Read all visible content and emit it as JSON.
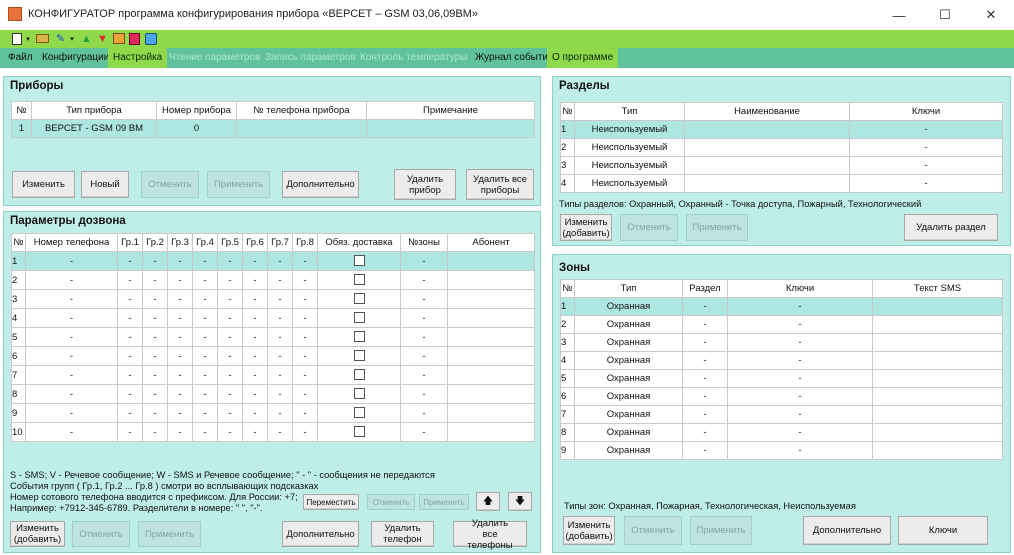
{
  "window": {
    "title": "КОНФИГУРАТОР программа конфигурирования прибора «ВЕРСЕТ – GSM 03,06,09ВМ»",
    "minimize": "—",
    "maximize": "☐",
    "close": "✕"
  },
  "toolbar": {
    "icons": [
      "new-file-icon",
      "open-icon",
      "wizard-icon",
      "upload-icon",
      "download-icon",
      "device-icon",
      "book-icon",
      "settings-icon"
    ]
  },
  "menu": [
    {
      "label": "Файл",
      "state": "normal"
    },
    {
      "label": "Конфигурации",
      "state": "normal"
    },
    {
      "label": "Настройка",
      "state": "active"
    },
    {
      "label": "Чтение параметров",
      "state": "disabled"
    },
    {
      "label": "Запись параметров",
      "state": "disabled"
    },
    {
      "label": "Контроль температуры",
      "state": "disabled"
    },
    {
      "label": "Журнал событий",
      "state": "normal"
    },
    {
      "label": "О программе",
      "state": "active"
    }
  ],
  "devices": {
    "title": "Приборы",
    "columns": [
      "№",
      "Тип прибора",
      "Номер прибора",
      "№ телефона прибора",
      "Примечание"
    ],
    "rows": [
      [
        "1",
        "ВЕРСЕТ - GSM 09 ВМ",
        "0",
        "",
        ""
      ]
    ],
    "buttons": {
      "edit": "Изменить",
      "new": "Новый",
      "cancel": "Отменить",
      "apply": "Применить",
      "extra": "Дополнительно",
      "delete_one": "Удалить прибор",
      "delete_all": "Удалить все приборы"
    }
  },
  "dial": {
    "title": "Параметры дозвона",
    "columns": [
      "№",
      "Номер телефона",
      "Гр.1",
      "Гр.2",
      "Гр.3",
      "Гр.4",
      "Гр.5",
      "Гр.6",
      "Гр.7",
      "Гр.8",
      "Обяз. доставка",
      "№зоны",
      "Абонент"
    ],
    "rows": [
      [
        "1",
        "-",
        "-",
        "-",
        "-",
        "-",
        "-",
        "-",
        "-",
        "-",
        "",
        "-",
        ""
      ],
      [
        "2",
        "-",
        "-",
        "-",
        "-",
        "-",
        "-",
        "-",
        "-",
        "-",
        "",
        "-",
        ""
      ],
      [
        "3",
        "-",
        "-",
        "-",
        "-",
        "-",
        "-",
        "-",
        "-",
        "-",
        "",
        "-",
        ""
      ],
      [
        "4",
        "-",
        "-",
        "-",
        "-",
        "-",
        "-",
        "-",
        "-",
        "-",
        "",
        "-",
        ""
      ],
      [
        "5",
        "-",
        "-",
        "-",
        "-",
        "-",
        "-",
        "-",
        "-",
        "-",
        "",
        "-",
        ""
      ],
      [
        "6",
        "-",
        "-",
        "-",
        "-",
        "-",
        "-",
        "-",
        "-",
        "-",
        "",
        "-",
        ""
      ],
      [
        "7",
        "-",
        "-",
        "-",
        "-",
        "-",
        "-",
        "-",
        "-",
        "-",
        "",
        "-",
        ""
      ],
      [
        "8",
        "-",
        "-",
        "-",
        "-",
        "-",
        "-",
        "-",
        "-",
        "-",
        "",
        "-",
        ""
      ],
      [
        "9",
        "-",
        "-",
        "-",
        "-",
        "-",
        "-",
        "-",
        "-",
        "-",
        "",
        "-",
        ""
      ],
      [
        "10",
        "-",
        "-",
        "-",
        "-",
        "-",
        "-",
        "-",
        "-",
        "-",
        "",
        "-",
        ""
      ]
    ],
    "notes": [
      "S - SMS;  V - Речевое сообщение;  W - SMS и Речевое сообщение; \" - \" - сообщения не передаются",
      "События групп ( Гр.1, Гр.2 ... Гр.8 ) смотри во всплывающих подсказках",
      "Номер сотового телефона вводится с префиксом. Для России: +7;",
      "Например: +7912-345-6789. Разделители в номере: \" \", \"-\"."
    ],
    "mini_buttons": {
      "move": "Переместить",
      "cancel": "Отменить",
      "apply": "Применить",
      "up": "🡅",
      "down": "🡇"
    },
    "buttons": {
      "edit": "Изменить (добавить)",
      "cancel": "Отменить",
      "apply": "Применить",
      "extra": "Дополнительно",
      "delete_one": "Удалить телефон",
      "delete_all": "Удалить все телефоны"
    }
  },
  "sections": {
    "title": "Разделы",
    "columns": [
      "№",
      "Тип",
      "Наименование",
      "Ключи"
    ],
    "rows": [
      [
        "1",
        "Неиспользуемый",
        "",
        "-"
      ],
      [
        "2",
        "Неиспользуемый",
        "",
        "-"
      ],
      [
        "3",
        "Неиспользуемый",
        "",
        "-"
      ],
      [
        "4",
        "Неиспользуемый",
        "",
        "-"
      ]
    ],
    "types_note": "Типы разделов: Охранный, Охранный - Точка доступа, Пожарный, Технологический",
    "buttons": {
      "edit": "Изменить (добавить)",
      "cancel": "Отменить",
      "apply": "Применить",
      "delete": "Удалить раздел"
    }
  },
  "zones": {
    "title": "Зоны",
    "columns": [
      "№",
      "Тип",
      "Раздел",
      "Ключи",
      "Текст SMS"
    ],
    "rows": [
      [
        "1",
        "Охранная",
        "-",
        "-",
        ""
      ],
      [
        "2",
        "Охранная",
        "-",
        "-",
        ""
      ],
      [
        "3",
        "Охранная",
        "-",
        "-",
        ""
      ],
      [
        "4",
        "Охранная",
        "-",
        "-",
        ""
      ],
      [
        "5",
        "Охранная",
        "-",
        "-",
        ""
      ],
      [
        "6",
        "Охранная",
        "-",
        "-",
        ""
      ],
      [
        "7",
        "Охранная",
        "-",
        "-",
        ""
      ],
      [
        "8",
        "Охранная",
        "-",
        "-",
        ""
      ],
      [
        "9",
        "Охранная",
        "-",
        "-",
        ""
      ]
    ],
    "types_note": "Типы зон: Охранная, Пожарная, Технологическая, Неиспользуемая",
    "buttons": {
      "edit": "Изменить (добавить)",
      "cancel": "Отменить",
      "apply": "Применить",
      "extra": "Дополнительно",
      "keys": "Ключи"
    }
  },
  "colors": {
    "accent_green": "#8fd94a",
    "menu_teal": "#5fc29d",
    "panel": "#bfeee9",
    "selected_row": "#aee6e2"
  }
}
